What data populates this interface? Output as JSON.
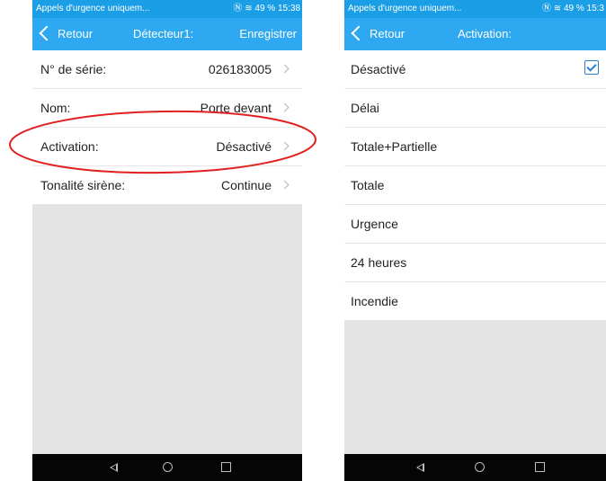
{
  "left_screen": {
    "statusbar": {
      "notice": "Appels d'urgence uniquem...",
      "icons": "Ⓝ ≋ 49 % 15:38"
    },
    "navbar": {
      "back_label": "Retour",
      "title": "Détecteur1:",
      "save_label": "Enregistrer"
    },
    "rows": [
      {
        "label": "N° de série:",
        "value": "026183005"
      },
      {
        "label": "Nom:",
        "value": "Porte devant"
      },
      {
        "label": "Activation:",
        "value": "Désactivé"
      },
      {
        "label": "Tonalité sirène:",
        "value": "Continue"
      }
    ]
  },
  "right_screen": {
    "statusbar": {
      "notice": "Appels d'urgence uniquem...",
      "icons": "Ⓝ ≋ 49 % 15:3"
    },
    "navbar": {
      "back_label": "Retour",
      "title": "Activation:"
    },
    "options": [
      {
        "label": "Désactivé",
        "selected": true
      },
      {
        "label": "Délai",
        "selected": false
      },
      {
        "label": "Totale+Partielle",
        "selected": false
      },
      {
        "label": "Totale",
        "selected": false
      },
      {
        "label": "Urgence",
        "selected": false
      },
      {
        "label": "24 heures",
        "selected": false
      },
      {
        "label": "Incendie",
        "selected": false
      }
    ]
  },
  "icons": {
    "back": "chevron-left-icon",
    "row_arrow": "chevron-right-icon",
    "check": "checkbox-checked-icon",
    "nav_back": "triangle-back-icon",
    "nav_home": "circle-home-icon",
    "nav_recent": "square-recent-icon"
  },
  "colors": {
    "navbar": "#2ea8f0",
    "statusbar": "#1a9ee6",
    "highlight": "#e0201e",
    "empty_area": "#e3e3e3",
    "bottom_nav": "#050505"
  }
}
